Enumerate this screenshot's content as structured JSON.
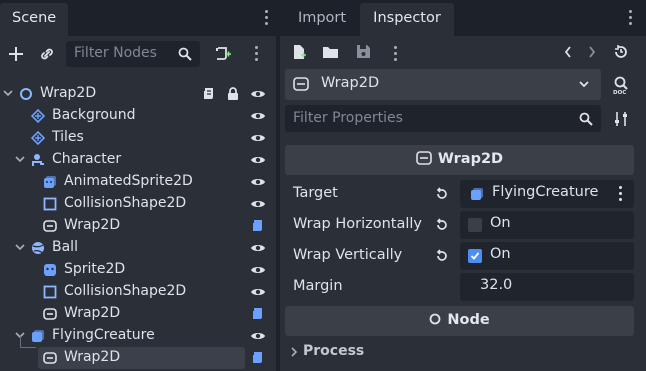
{
  "scene_dock": {
    "tab_label": "Scene",
    "filter_placeholder": "Filter Nodes",
    "tree": [
      {
        "label": "Wrap2D",
        "icon": "node2d-circle-icon",
        "color": "#8eb7ff"
      },
      {
        "label": "Background",
        "icon": "parallax-icon",
        "color": "#6ca0ff"
      },
      {
        "label": "Tiles",
        "icon": "tilemap-icon",
        "color": "#6ca0ff"
      },
      {
        "label": "Character",
        "icon": "character-icon",
        "color": "#8eb7ff"
      },
      {
        "label": "AnimatedSprite2D",
        "icon": "animated-sprite-icon",
        "color": "#6ca0ff"
      },
      {
        "label": "CollisionShape2D",
        "icon": "collision-shape-icon",
        "color": "#8eb7ff"
      },
      {
        "label": "Wrap2D",
        "icon": "wrap2d-icon",
        "color": "#dfe3e8"
      },
      {
        "label": "Ball",
        "icon": "rigidbody-icon",
        "color": "#8eb7ff"
      },
      {
        "label": "Sprite2D",
        "icon": "sprite-icon",
        "color": "#6ca0ff"
      },
      {
        "label": "CollisionShape2D",
        "icon": "collision-shape-icon",
        "color": "#8eb7ff"
      },
      {
        "label": "Wrap2D",
        "icon": "wrap2d-icon",
        "color": "#dfe3e8"
      },
      {
        "label": "FlyingCreature",
        "icon": "animatable-body-icon",
        "color": "#6ca0ff"
      },
      {
        "label": "Wrap2D",
        "icon": "wrap2d-icon",
        "color": "#dfe3e8"
      }
    ]
  },
  "inspector_dock": {
    "tabs": [
      "Import",
      "Inspector"
    ],
    "object_selector": "Wrap2D",
    "filter_placeholder": "Filter Properties",
    "script_section": "Wrap2D",
    "properties": {
      "target_label": "Target",
      "target_value": "FlyingCreature",
      "wrap_h_label": "Wrap Horizontally",
      "wrap_h_value": "On",
      "wrap_v_label": "Wrap Vertically",
      "wrap_v_value": "On",
      "margin_label": "Margin",
      "margin_value": "32.0"
    },
    "node_section": "Node",
    "process_label": "Process"
  }
}
